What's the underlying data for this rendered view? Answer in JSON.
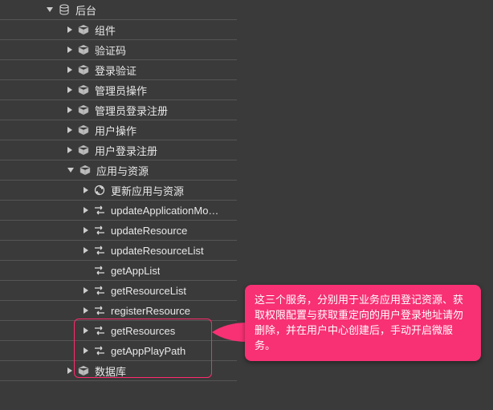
{
  "tree": {
    "root": {
      "label": "后台"
    },
    "level1": [
      {
        "label": "组件"
      },
      {
        "label": "验证码"
      },
      {
        "label": "登录验证"
      },
      {
        "label": "管理员操作"
      },
      {
        "label": "管理员登录注册"
      },
      {
        "label": "用户操作"
      },
      {
        "label": "用户登录注册"
      },
      {
        "label": "应用与资源",
        "expanded": true
      },
      {
        "label": "数据库"
      }
    ],
    "appres_children": [
      {
        "label": "更新应用与资源",
        "icon": "refresh",
        "arrow": true
      },
      {
        "label": "updateApplicationMo…",
        "icon": "flow",
        "arrow": true
      },
      {
        "label": "updateResource",
        "icon": "flow",
        "arrow": true
      },
      {
        "label": "updateResourceList",
        "icon": "flow",
        "arrow": true
      },
      {
        "label": "getAppList",
        "icon": "flow",
        "arrow": false
      },
      {
        "label": "getResourceList",
        "icon": "flow",
        "arrow": true
      },
      {
        "label": "registerResource",
        "icon": "flow",
        "arrow": true
      },
      {
        "label": "getResources",
        "icon": "flow",
        "arrow": true
      },
      {
        "label": "getAppPlayPath",
        "icon": "flow",
        "arrow": true
      }
    ]
  },
  "callout": {
    "text": "这三个服务，分别用于业务应用登记资源、获取权限配置与获取重定向的用户登录地址请勿删除，并在用户中心创建后，手动开启微服务。"
  }
}
